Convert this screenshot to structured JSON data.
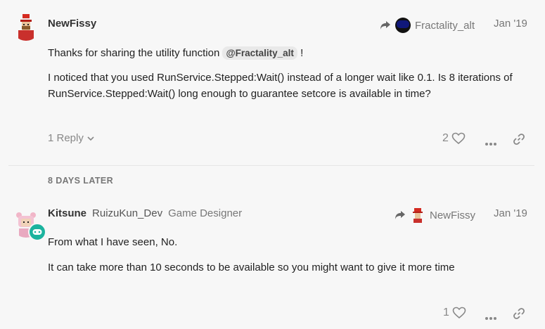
{
  "post1": {
    "username": "NewFissy",
    "reply_to_user": "Fractality_alt",
    "date": "Jan '19",
    "text_before_mention": "Thanks for sharing the utility function ",
    "mention": "@Fractality_alt",
    "text_after_mention": " !",
    "paragraph2": "I noticed that you used RunService.Stepped:Wait() instead of a longer wait like 0.1. Is 8 iterations of RunService.Stepped:Wait() long enough to guarantee setcore is available in time?",
    "replies_label": "1 Reply",
    "like_count": "2"
  },
  "time_gap": "8 DAYS LATER",
  "post2": {
    "username": "Kitsune",
    "secondary_name": "RuizuKun_Dev",
    "title": "Game Designer",
    "reply_to_user": "NewFissy",
    "date": "Jan '19",
    "paragraph1": "From what I have seen, No.",
    "paragraph2": "It can take more than 10 seconds to be available so you might want to give it more time",
    "like_count": "1"
  },
  "icons": {
    "reply_arrow": "share-arrow-icon",
    "heart": "heart-icon",
    "more": "ellipsis-icon",
    "link": "link-icon",
    "chevron": "chevron-down-icon",
    "flair": "gamepad-icon"
  },
  "colors": {
    "background": "#f7f7f7",
    "flair": "#1bb39e",
    "accent_red": "#d42a20"
  }
}
